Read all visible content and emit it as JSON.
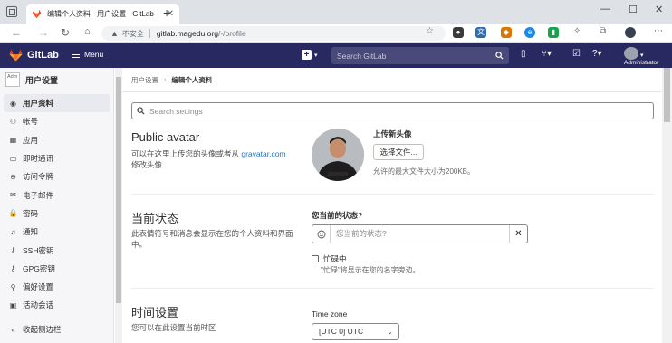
{
  "browser": {
    "tab_title": "编辑个人资料 · 用户设置 · GitLab",
    "insecure_label": "不安全",
    "url_host": "gitlab.magedu.org",
    "url_path": "/-/profile"
  },
  "topbar": {
    "brand": "GitLab",
    "menu_label": "Menu",
    "search_placeholder": "Search GitLab",
    "user_label": "Administrator"
  },
  "sidebar": {
    "avatar_alt": "Adm",
    "title": "用户设置",
    "items": [
      {
        "label": "用户资料",
        "icon": "user-circle-icon"
      },
      {
        "label": "帐号",
        "icon": "account-icon"
      },
      {
        "label": "应用",
        "icon": "applications-icon"
      },
      {
        "label": "即时通讯",
        "icon": "chat-icon"
      },
      {
        "label": "访问令牌",
        "icon": "token-icon"
      },
      {
        "label": "电子邮件",
        "icon": "mail-icon"
      },
      {
        "label": "密码",
        "icon": "lock-icon"
      },
      {
        "label": "通知",
        "icon": "bell-icon"
      },
      {
        "label": "SSH密钥",
        "icon": "key-icon"
      },
      {
        "label": "GPG密钥",
        "icon": "key-icon"
      },
      {
        "label": "偏好设置",
        "icon": "preferences-icon"
      },
      {
        "label": "活动会话",
        "icon": "monitor-icon"
      }
    ],
    "collapse_label": "收起侧边栏"
  },
  "breadcrumb": {
    "parent": "用户设置",
    "current": "编辑个人资料"
  },
  "search_settings_placeholder": "Search settings",
  "avatar_section": {
    "title": "Public avatar",
    "desc_before": "可以在这里上传您的头像或者从 ",
    "desc_link": "gravatar.com",
    "desc_after": " 修改头像",
    "upload_title": "上传新头像",
    "choose_button": "选择文件...",
    "max_size": "允许的最大文件大小为200KB。"
  },
  "status_section": {
    "title": "当前状态",
    "desc": "此表情符号和消息会显示在您的个人资料和界面中。",
    "label": "您当前的状态?",
    "placeholder": "您当前的状态?",
    "busy_label": "忙碌中",
    "busy_help": "\"忙碌\"将显示在您的名字旁边。",
    "busy_checked": false
  },
  "time_section": {
    "title": "时间设置",
    "desc": "您可以在此设置当前时区",
    "tz_label": "Time zone",
    "tz_value": "[UTC 0] UTC"
  },
  "colors": {
    "topbar": "#292961",
    "link": "#1f75cb",
    "sidebar_bg": "#f6f6f8"
  }
}
